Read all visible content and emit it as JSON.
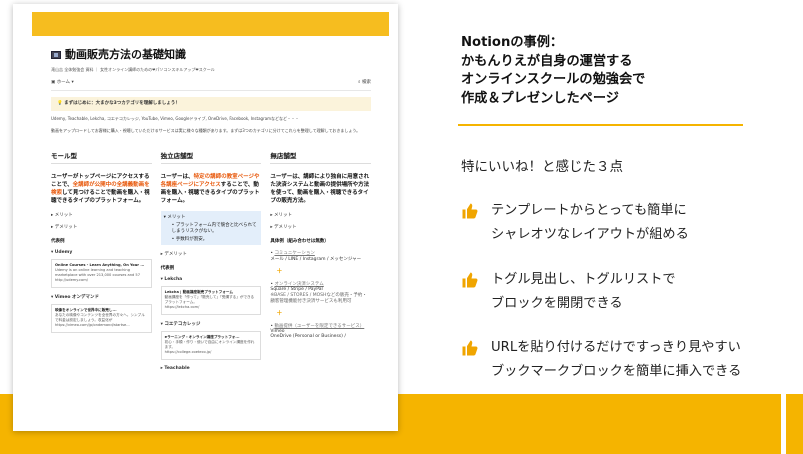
{
  "doc": {
    "title": "動画販売方法の基礎知識",
    "meta": "滝山吉 全体勉強会 資料 ｜ 女性オンライン講師のための❤パソコンスキルアップ❤スクール",
    "home": "ホーム",
    "search": "検索",
    "callout": "まずはじめに：大まかな3つカテゴリを理解しましょう！",
    "intro_1": "Udemy, Teachable, Lekcha, コエテコカレッジ, YouTube, Vimeo, Googleドライブ, OneDrive, Facebook, Instagramなどなど・・・",
    "intro_2": "動画をアップロードしてお客様に購入・視聴していただけるサービスは実に様々な種類があります。まずは3つのカテゴリに分けてこれらを整理して理解しておきましょう。",
    "columns": [
      {
        "heading": "モール型",
        "lead_a": "ユーザーがトップページにアクセスすることで、",
        "lead_hl": "全講師が公開中の全講義動画を検索",
        "lead_b": "して見つけることで動画を購入・視聴できるタイプのプラットフォーム。",
        "toggle1": "メリット",
        "toggle2": "デメリット",
        "examples": "代表例",
        "ex1": "Udemy",
        "card1_title": "Online Courses - Learn Anything, On Your ...",
        "card1_desc": "Udemy is an online learning and teaching marketplace with over 213,000 courses and 57",
        "card1_url": "http://udemy.com/",
        "ex2": "Vimeo オンデマンド",
        "card2_title": "映像をオンラインで世界中に販売し...",
        "card2_desc": "あなたの映像やコンテンツを全世界の方々へ。シンプルで料金は設定しましょう。収益化が",
        "card2_url": "https://vimeo.com/jp/ondemand/startse..."
      },
      {
        "heading": "独立店舗型",
        "lead_a": "ユーザーは、",
        "lead_hl": "特定の講師の教室ページや各講座ページにアクセス",
        "lead_b": "することで、動画を購入・視聴できるタイプのプラットフォーム。",
        "toggle1": "メリット",
        "bullet1": "プラットフォーム内で競合と比べられてしまうリスクがない。",
        "bullet2": "手数料が割安。",
        "toggle2": "デメリット",
        "examples": "代表例",
        "ex1": "Lekcha",
        "card1_title": "Lekcha | 動画講座販売プラットフォーム",
        "card1_desc": "動画講座を「作って」「販売して」「受講する」ができるプラットフォーム。",
        "card1_url": "https://lekcha.com/",
        "ex2": "コエテコカレッジ",
        "card2_title": "eラーニング・オンライン講座プラットフォ...",
        "card2_desc": "初心・手順・作り・使いで自由にオンライン講座を作れます。",
        "card2_url": "https://college.coeteco.jp/",
        "ex3": "Teachable"
      },
      {
        "heading": "無店舗型",
        "lead": "ユーザーは、講師により独自に用意された決済システムと動画の提供場所や方法を使って、動画を購入・視聴できるタイプの販売方法。",
        "toggle1": "メリット",
        "toggle2": "デメリット",
        "examples": "具体例（組み合わせは無数）",
        "b1_link": "コミュニケーション",
        "b1_text": "メール / LINE / Instagram / メッセンジャー",
        "b2_link": "オンライン決済システム",
        "b2_text": "Square / Stripe / PayPal",
        "b2_note": "※BASE / STORES / MOSHなどの販売・予約・顧客管理機能付き決済サービスも利用可",
        "b3_link": "動画提供（ユーザーを限定できるサービス）",
        "b3_text1": "Vimeo",
        "b3_text2": "OneDrive (Personal  or Business) /"
      }
    ]
  },
  "right": {
    "title_lines": [
      "Notionの事例：",
      "かもんりえが自身の運営する",
      "オンラインスクールの勉強会で",
      "作成＆プレゼンしたページ"
    ],
    "points_head": "特にいいね！と感じた３点",
    "points": [
      {
        "line1": "テンプレートからとっても簡単に",
        "line2": "シャレオツなレイアウトが組める"
      },
      {
        "line1": "トグル見出し、トグルリストで",
        "line2": "ブロックを開閉できる"
      },
      {
        "line1": "URLを貼り付けるだけですっきり見やすい",
        "line2": "ブックマークブロックを簡単に挿入できる"
      }
    ]
  },
  "colors": {
    "accent": "#f5b400",
    "highlight": "#e8590c",
    "thumb": "#f0a500"
  }
}
